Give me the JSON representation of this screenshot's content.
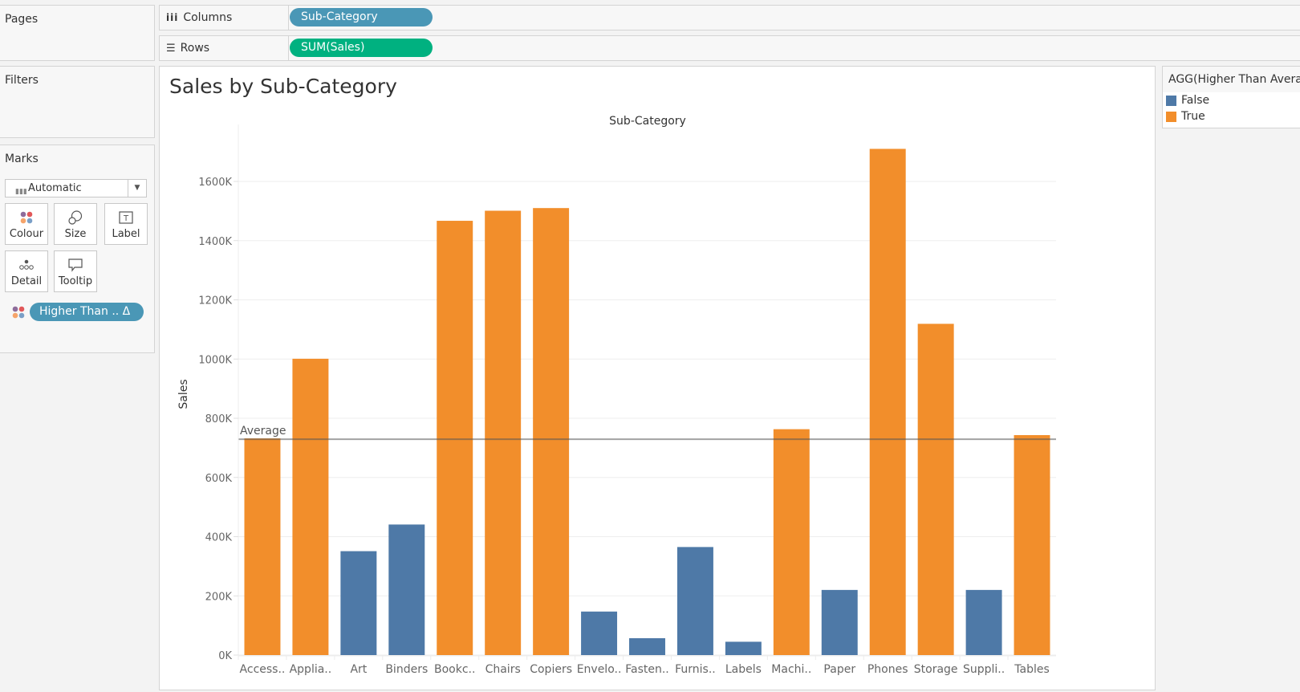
{
  "panels": {
    "pages": "Pages",
    "filters": "Filters",
    "marks": "Marks"
  },
  "shelves": {
    "columns": {
      "label": "Columns",
      "icon": "columns-icon",
      "pill": "Sub-Category",
      "pill_color": "#4a97b6"
    },
    "rows": {
      "label": "Rows",
      "icon": "rows-icon",
      "pill": "SUM(Sales)",
      "pill_color": "#00b180"
    }
  },
  "marks": {
    "type": "Automatic",
    "buttons": [
      {
        "label": "Colour",
        "icon": "colour-icon"
      },
      {
        "label": "Size",
        "icon": "size-icon"
      },
      {
        "label": "Label",
        "icon": "label-icon"
      },
      {
        "label": "Detail",
        "icon": "detail-icon"
      },
      {
        "label": "Tooltip",
        "icon": "tooltip-icon"
      }
    ],
    "colour_pill": "Higher Than .. Δ",
    "colour_pill_color": "#4a97b6"
  },
  "legend": {
    "title": "AGG(Higher Than Average)",
    "items": [
      {
        "label": "False",
        "color": "#4e79a7"
      },
      {
        "label": "True",
        "color": "#f28e2b"
      }
    ]
  },
  "chart_data": {
    "type": "bar",
    "title": "Sales by Sub-Category",
    "xlabel": "Sub-Category",
    "ylabel": "Sales",
    "categories": [
      "Access..",
      "Applia..",
      "Art",
      "Binders",
      "Bookc..",
      "Chairs",
      "Copiers",
      "Envelo..",
      "Fasten..",
      "Furnis..",
      "Labels",
      "Machi..",
      "Paper",
      "Phones",
      "Storage",
      "Suppli..",
      "Tables"
    ],
    "values": [
      732000,
      1001000,
      351000,
      441000,
      1467000,
      1501000,
      1510000,
      147000,
      57000,
      365000,
      45000,
      763000,
      220000,
      1710000,
      1119000,
      220000,
      743000
    ],
    "higher_than_average": [
      true,
      true,
      false,
      false,
      true,
      true,
      true,
      false,
      false,
      false,
      false,
      true,
      false,
      true,
      true,
      false,
      true
    ],
    "colors": {
      "false": "#4e79a7",
      "true": "#f28e2b"
    },
    "reference_line": {
      "label": "Average",
      "value": 729000
    },
    "yticks": [
      0,
      200000,
      400000,
      600000,
      800000,
      1000000,
      1200000,
      1400000,
      1600000
    ],
    "ytick_labels": [
      "0K",
      "200K",
      "400K",
      "600K",
      "800K",
      "1000K",
      "1200K",
      "1400K",
      "1600K"
    ],
    "ylim": [
      0,
      1820000
    ],
    "grid": true,
    "legend_position": "right"
  }
}
